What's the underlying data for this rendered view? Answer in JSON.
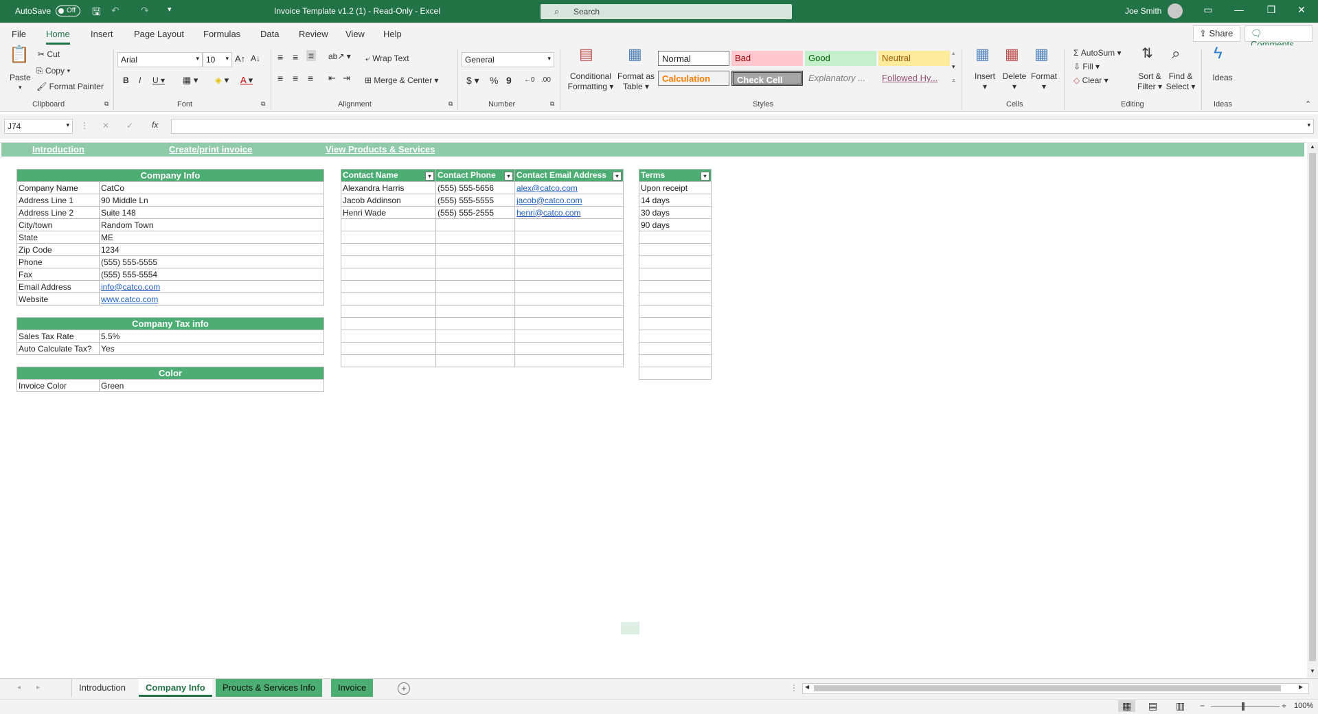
{
  "titlebar": {
    "autosave_label": "AutoSave",
    "autosave_state": "Off",
    "document_title": "Invoice Template v1.2 (1)  -  Read-Only  -  Excel",
    "search_placeholder": "Search",
    "user_name": "Joe Smith"
  },
  "menu": {
    "tabs": [
      "File",
      "Home",
      "Insert",
      "Page Layout",
      "Formulas",
      "Data",
      "Review",
      "View",
      "Help"
    ],
    "active_tab": "Home",
    "share_label": "Share",
    "comments_label": "Comments"
  },
  "ribbon": {
    "clipboard": {
      "paste": "Paste",
      "cut": "Cut",
      "copy": "Copy",
      "format_painter": "Format Painter",
      "group": "Clipboard"
    },
    "font": {
      "family": "Arial",
      "size": "10",
      "group": "Font"
    },
    "alignment": {
      "wrap_text": "Wrap Text",
      "merge_center": "Merge & Center",
      "group": "Alignment"
    },
    "number": {
      "format": "General",
      "group": "Number"
    },
    "styles": {
      "conditional_formatting": [
        "Conditional",
        "Formatting"
      ],
      "format_as_table": [
        "Format as",
        "Table"
      ],
      "cells": [
        "Normal",
        "Bad",
        "Good",
        "Neutral",
        "Calculation",
        "Check Cell",
        "Explanatory ...",
        "Followed Hy..."
      ],
      "group": "Styles"
    },
    "cells": {
      "insert": "Insert",
      "delete": "Delete",
      "format": "Format",
      "group": "Cells"
    },
    "editing": {
      "autosum": "AutoSum",
      "fill": "Fill",
      "clear": "Clear",
      "sort_filter": [
        "Sort &",
        "Filter"
      ],
      "find_select": [
        "Find &",
        "Select"
      ],
      "group": "Editing"
    },
    "ideas": {
      "label": "Ideas",
      "group": "Ideas"
    }
  },
  "formula_bar": {
    "name_box": "J74",
    "fx": "fx",
    "formula": ""
  },
  "nav_links": [
    "Introduction",
    "Create/print invoice",
    "View Products & Services"
  ],
  "company_info": {
    "title": "Company Info",
    "rows": [
      [
        "Company Name",
        "CatCo"
      ],
      [
        "Address Line 1",
        "90 Middle Ln"
      ],
      [
        "Address Line 2",
        "Suite 148"
      ],
      [
        "City/town",
        "Random Town"
      ],
      [
        "State",
        "ME"
      ],
      [
        "Zip Code",
        "1234"
      ],
      [
        "Phone",
        "(555) 555-5555"
      ],
      [
        "Fax",
        "(555) 555-5554"
      ],
      [
        "Email Address",
        "info@catco.com"
      ],
      [
        "Website",
        "www.catco.com"
      ]
    ]
  },
  "company_tax": {
    "title": "Company Tax info",
    "rows": [
      [
        "Sales Tax Rate",
        "5.5%"
      ],
      [
        "Auto Calculate Tax?",
        "Yes"
      ]
    ]
  },
  "color": {
    "title": "Color",
    "rows": [
      [
        "Invoice Color",
        "Green"
      ]
    ]
  },
  "contacts": {
    "headers": [
      "Contact Name",
      "Contact Phone",
      "Contact Email Address"
    ],
    "rows": [
      [
        "Alexandra Harris",
        "(555) 555-5656",
        "alex@catco.com"
      ],
      [
        "Jacob Addinson",
        "(555) 555-5555",
        "jacob@catco.com"
      ],
      [
        "Henri Wade",
        "(555) 555-2555",
        "henri@catco.com"
      ]
    ]
  },
  "terms": {
    "header": "Terms",
    "rows": [
      "Upon receipt",
      "14 days",
      "30 days",
      "90 days"
    ]
  },
  "sheet_tabs": [
    "Introduction",
    "Company Info",
    "Proucts & Services Info",
    "Invoice"
  ],
  "active_sheet": "Company Info",
  "status": {
    "zoom": "100%"
  },
  "colors": {
    "brand": "#217346",
    "header_green": "#4cae72",
    "nav_band": "#8fcba9"
  }
}
